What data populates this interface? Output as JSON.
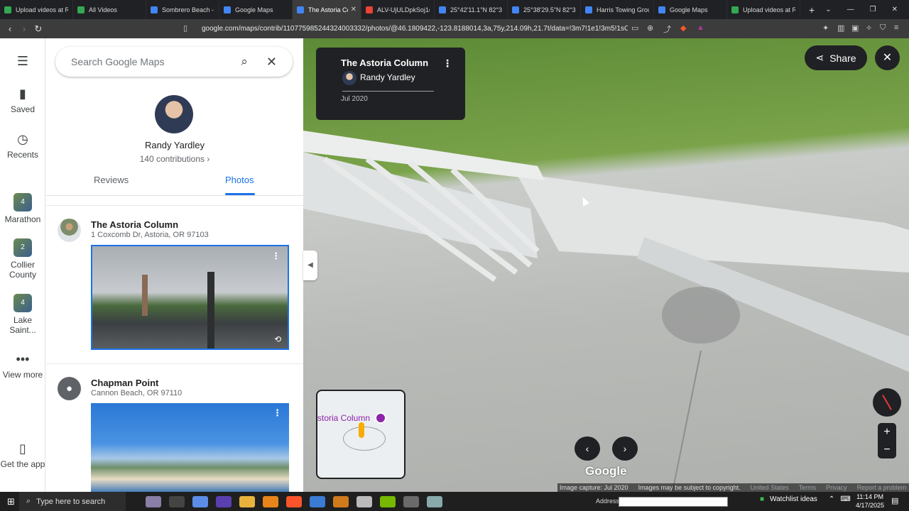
{
  "browser": {
    "tabs": [
      {
        "title": "Upload videos at R",
        "color": "#34a853"
      },
      {
        "title": "All Videos",
        "color": "#34a853"
      },
      {
        "title": "Sombrero Beach - C",
        "color": "#4285f4"
      },
      {
        "title": "Google Maps",
        "color": "#4285f4"
      },
      {
        "title": "The Astoria Co",
        "color": "#4285f4"
      },
      {
        "title": "ALV-UjULDpkSoj1c",
        "color": "#ea4335"
      },
      {
        "title": "25°42'11.1\"N 82°3",
        "color": "#4285f4"
      },
      {
        "title": "25°38'29.5\"N 82°3",
        "color": "#4285f4"
      },
      {
        "title": "Harris Towing Grou",
        "color": "#4285f4"
      },
      {
        "title": "Google Maps",
        "color": "#4285f4"
      },
      {
        "title": "Upload videos at R",
        "color": "#34a853"
      }
    ],
    "url": "google.com/maps/contrib/110775985244324003332/photos/@46.1809422,-123.8188014,3a,75y,214.09h,21.7t/data=!3m7!1e1!3m5!1sClH..."
  },
  "rail": {
    "items": [
      {
        "label": "Saved",
        "icon": "bookmark-icon"
      },
      {
        "label": "Recents",
        "icon": "history-icon"
      },
      {
        "label": "Marathon",
        "badge": "4"
      },
      {
        "label": "Collier County",
        "badge": "2"
      },
      {
        "label": "Lake Saint...",
        "badge": "4"
      },
      {
        "label": "View more",
        "icon": "more-icon"
      },
      {
        "label": "Get the app",
        "icon": "phone-icon"
      }
    ]
  },
  "panel": {
    "search_placeholder": "Search Google Maps",
    "user_name": "Randy Yardley",
    "contributions": "140 contributions",
    "tabs": [
      "Reviews",
      "Photos"
    ],
    "places": [
      {
        "title": "The Astoria Column",
        "address": "1 Coxcomb Dr, Astoria, OR 97103"
      },
      {
        "title": "Chapman Point",
        "address": "Cannon Beach, OR 97110"
      }
    ]
  },
  "viewer": {
    "title": "The Astoria Column",
    "author": "Randy Yardley",
    "date": "Jul 2020",
    "share_label": "Share",
    "minimap_label": "storia Column",
    "google_logo": "Google",
    "footer": [
      "Image capture: Jul 2020",
      "Images may be subject to copyright.",
      "United States",
      "Terms",
      "Privacy",
      "Report a problem"
    ]
  },
  "taskbar": {
    "search_placeholder": "Type here to search",
    "address_label": "Address",
    "watchlist": "Watchlist ideas",
    "time": "11:14 PM",
    "date": "4/17/2025"
  }
}
